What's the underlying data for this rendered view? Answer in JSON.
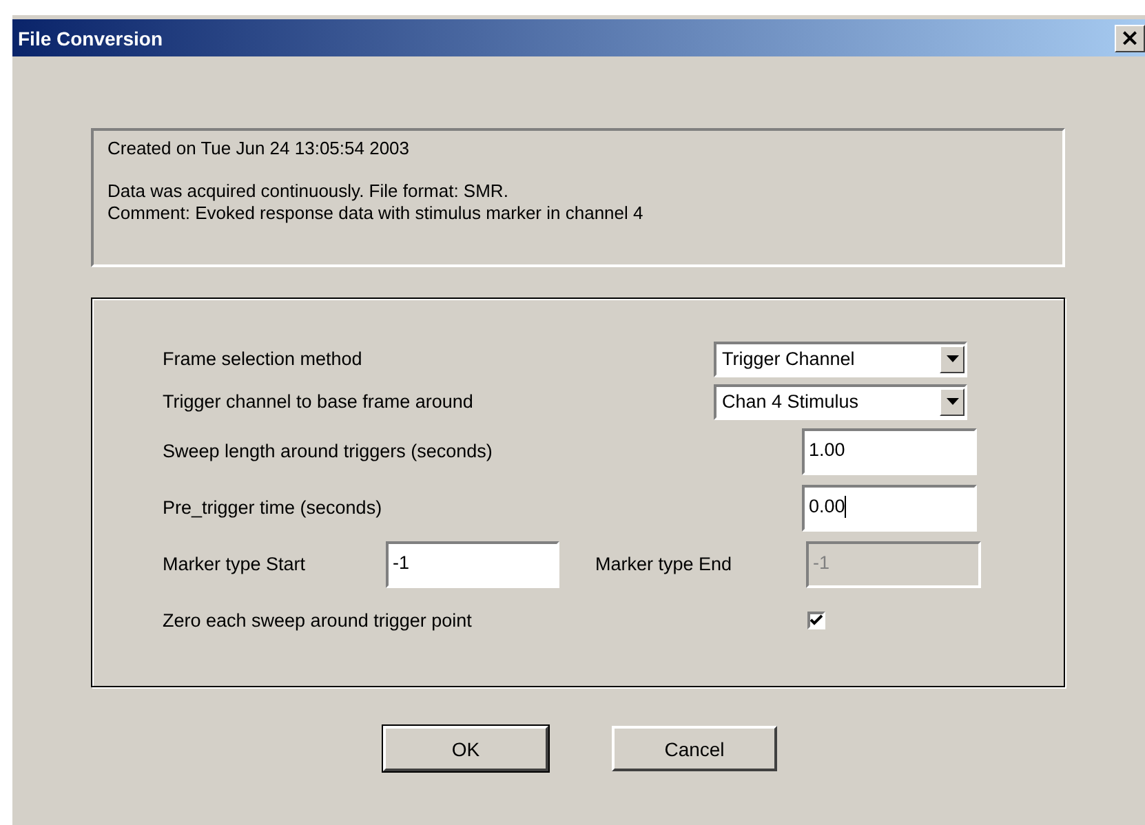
{
  "window": {
    "title": "File Conversion",
    "close": "×"
  },
  "info": {
    "created": "Created on Tue Jun 24 13:05:54 2003",
    "lines": [
      "Data was acquired continuously. File format: SMR.",
      "Comment: Evoked response data with stimulus marker in channel 4"
    ]
  },
  "settings": [
    {
      "kind": "dropdown",
      "label": "Frame selection method",
      "value": "Trigger Channel"
    },
    {
      "kind": "dropdown",
      "label": "Trigger channel to base frame around",
      "value": "Chan 4 Stimulus"
    },
    {
      "kind": "text",
      "label": "Sweep length around triggers (seconds)",
      "value": "1.00",
      "focused": false
    },
    {
      "kind": "text",
      "label": "Pre_trigger time (seconds)",
      "value": "0.00",
      "focused": true
    },
    {
      "kind": "pair",
      "label": "Marker type Start",
      "value": "-1",
      "disabled": false,
      "label2": "Marker type End",
      "value2": "-1",
      "disabled2": true
    },
    {
      "kind": "checkbox",
      "label": "Zero each sweep around trigger point",
      "checked": true
    }
  ],
  "buttons": [
    {
      "label": "OK",
      "default": true
    },
    {
      "label": "Cancel",
      "default": false
    }
  ]
}
